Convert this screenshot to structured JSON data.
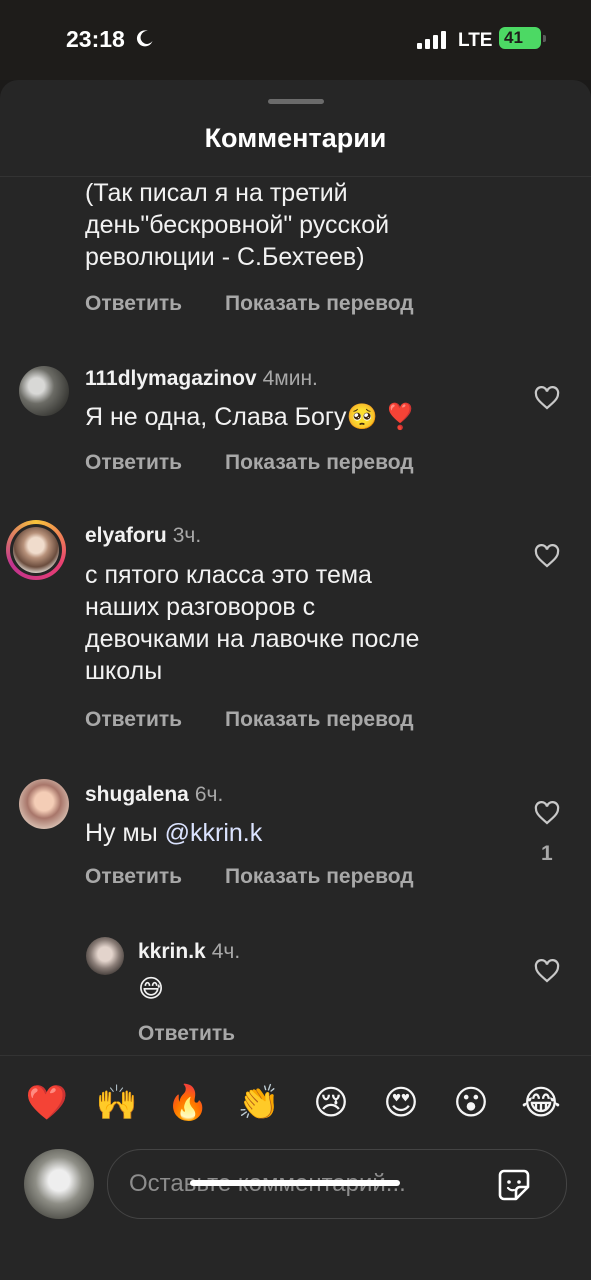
{
  "status_bar": {
    "time": "23:18",
    "network": "LTE",
    "battery": "41"
  },
  "sheet": {
    "title": "Комментарии"
  },
  "actions": {
    "reply": "Ответить",
    "translate": "Показать перевод"
  },
  "comments": [
    {
      "text_lines": [
        "(Так писал я на третий",
        "день\"бескровной\" русской",
        "революции - С.Бехтеев)"
      ]
    },
    {
      "username": "111dlymagazinov",
      "time": "4мин.",
      "text": "Я не одна, Слава Богу🥺 ❣️"
    },
    {
      "username": "elyaforu",
      "time": "3ч.",
      "text_lines": [
        "с пятого класса это тема",
        "наших разговоров с",
        "девочками на лавочке после",
        "школы"
      ]
    },
    {
      "username": "shugalena",
      "time": "6ч.",
      "text_prefix": "Ну мы",
      "mention": "@kkrin.k",
      "likes": "1"
    },
    {
      "username": "kkrin.k",
      "time": "4ч.",
      "text": "😅"
    }
  ],
  "reactions": [
    "❤️",
    "🙌",
    "🔥",
    "👏",
    "😢",
    "😍",
    "😮",
    "😂"
  ],
  "input": {
    "placeholder": "Оставьте комментарий..."
  },
  "icons": {
    "moon": "moon-icon",
    "signal": "signal-icon",
    "heart": "heart-icon",
    "sticker": "sticker-icon",
    "battery": "battery-icon"
  },
  "colors": {
    "background": "#262626",
    "secondary_text": "#a8a8a8",
    "battery": "#4cd964"
  }
}
